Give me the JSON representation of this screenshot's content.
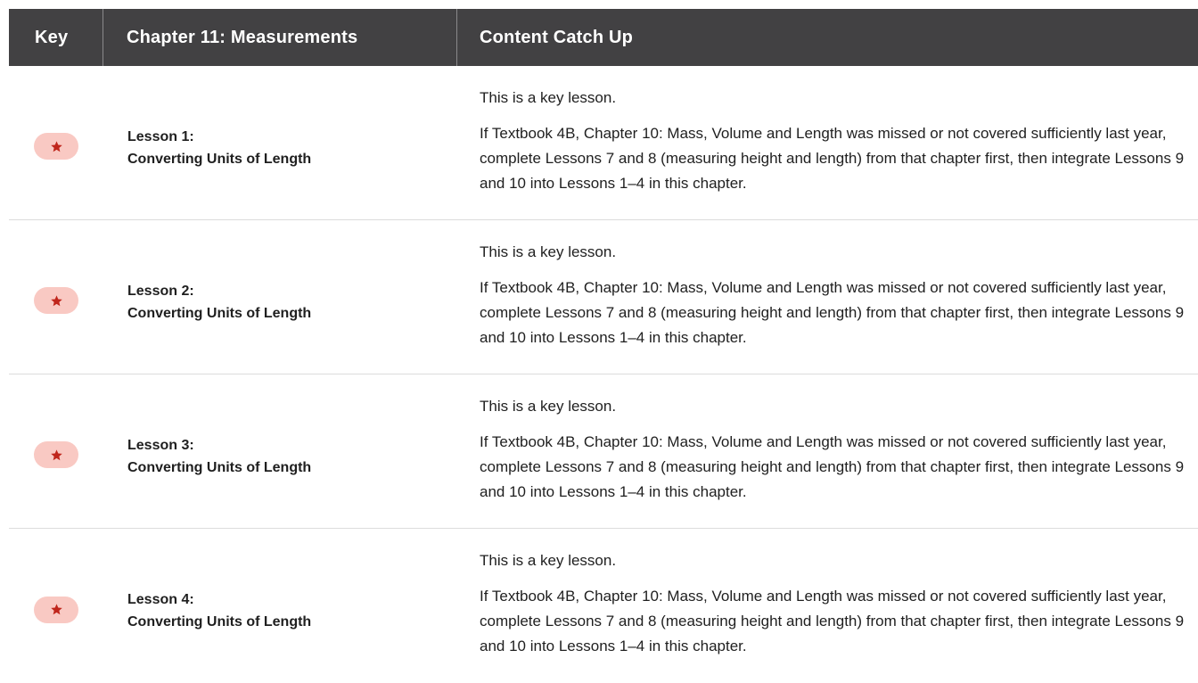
{
  "header": {
    "key_label": "Key",
    "chapter_label": "Chapter 11: Measurements",
    "content_label": "Content Catch Up"
  },
  "colors": {
    "header_bg": "#424143",
    "star_pill_bg": "#f9c9c3",
    "star_color": "#c0261c",
    "row_divider": "#dcdcdc"
  },
  "rows": [
    {
      "key_icon": "star-icon",
      "lesson_title": "Lesson 1:",
      "lesson_subtitle": "Converting Units of Length",
      "key_note": "This is a key lesson.",
      "content": "If Textbook 4B, Chapter 10: Mass, Volume and Length was missed or not covered sufficiently last year, complete Lessons 7 and 8 (measuring height and length) from that chapter first, then integrate Lessons 9 and 10 into Lessons 1–4 in this chapter."
    },
    {
      "key_icon": "star-icon",
      "lesson_title": "Lesson 2:",
      "lesson_subtitle": "Converting Units of Length",
      "key_note": "This is a key lesson.",
      "content": "If Textbook 4B, Chapter 10: Mass, Volume and Length was missed or not covered sufficiently last year, complete Lessons 7 and 8 (measuring height and length) from that chapter first, then integrate Lessons 9 and 10 into Lessons 1–4 in this chapter."
    },
    {
      "key_icon": "star-icon",
      "lesson_title": "Lesson 3:",
      "lesson_subtitle": "Converting Units of Length",
      "key_note": "This is a key lesson.",
      "content": "If Textbook 4B, Chapter 10: Mass, Volume and Length was missed or not covered sufficiently last year, complete Lessons 7 and 8 (measuring height and length) from that chapter first, then integrate Lessons 9 and 10 into Lessons 1–4 in this chapter."
    },
    {
      "key_icon": "star-icon",
      "lesson_title": "Lesson 4:",
      "lesson_subtitle": "Converting Units of Length",
      "key_note": "This is a key lesson.",
      "content": "If Textbook 4B, Chapter 10: Mass, Volume and Length was missed or not covered sufficiently last year, complete Lessons 7 and 8 (measuring height and length) from that chapter first, then integrate Lessons 9 and 10 into Lessons 1–4 in this chapter."
    }
  ]
}
